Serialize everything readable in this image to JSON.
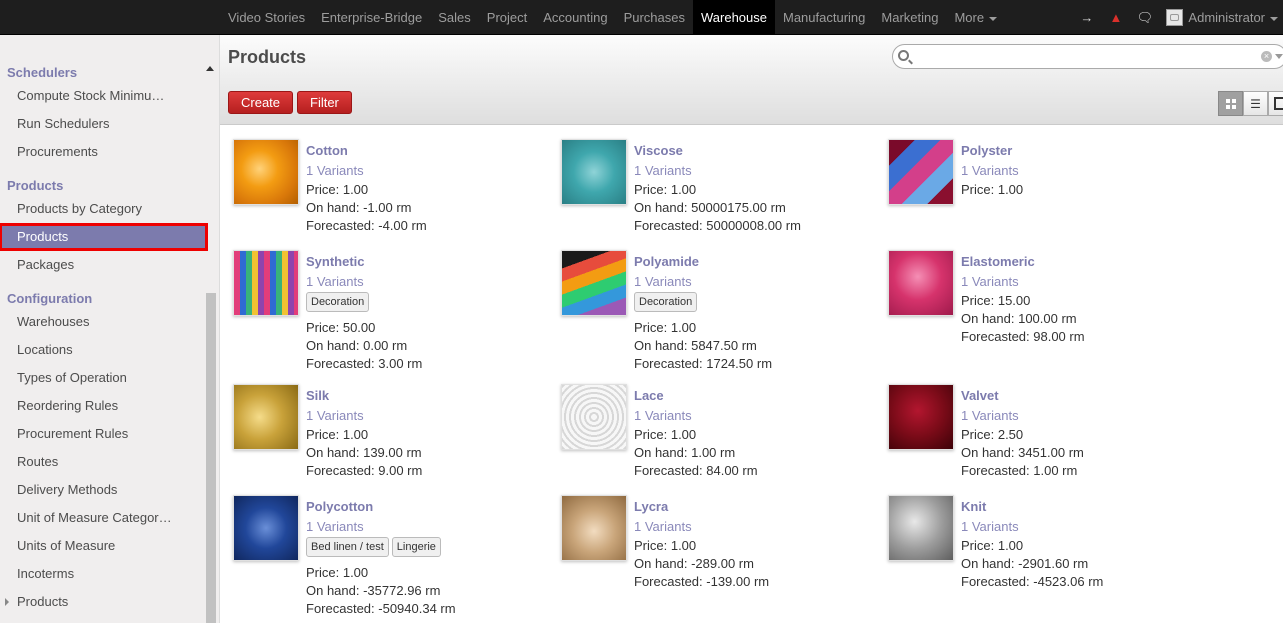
{
  "topnav": {
    "items": [
      "Video Stories",
      "Enterprise-Bridge",
      "Sales",
      "Project",
      "Accounting",
      "Purchases",
      "Warehouse",
      "Manufacturing",
      "Marketing"
    ],
    "more_label": "More",
    "active": "Warehouse",
    "user": "Administrator",
    "icons": [
      "sign-in-icon",
      "warning-icon",
      "chat-icon"
    ]
  },
  "sidebar": {
    "sections": [
      {
        "title": "Schedulers",
        "items": [
          "Compute Stock Minimu…",
          "Run Schedulers",
          "Procurements"
        ]
      },
      {
        "title": "Products",
        "items": [
          "Products by Category",
          "Products",
          "Packages"
        ]
      },
      {
        "title": "Configuration",
        "items": [
          "Warehouses",
          "Locations",
          "Types of Operation",
          "Reordering Rules",
          "Procurement Rules",
          "Routes",
          "Delivery Methods",
          "Unit of Measure Categor…",
          "Units of Measure",
          "Incoterms",
          "Products"
        ]
      }
    ],
    "active_item": "Products"
  },
  "page": {
    "title": "Products",
    "create_label": "Create",
    "filter_label": "Filter",
    "search_value": ""
  },
  "products": [
    {
      "name": "Cotton",
      "variants": "1 Variants",
      "tags": [],
      "price": "Price: 1.00",
      "onhand": "On hand: -1.00 rm",
      "forecast": "Forecasted: -4.00 rm"
    },
    {
      "name": "Viscose",
      "variants": "1 Variants",
      "tags": [],
      "price": "Price: 1.00",
      "onhand": "On hand: 50000175.00 rm",
      "forecast": "Forecasted: 50000008.00 rm"
    },
    {
      "name": "Polyster",
      "variants": "1 Variants",
      "tags": [],
      "price": "Price: 1.00"
    },
    {
      "name": "Synthetic",
      "variants": "1 Variants",
      "tags": [
        "Decoration"
      ],
      "price": "Price: 50.00",
      "onhand": "On hand: 0.00 rm",
      "forecast": "Forecasted: 3.00 rm"
    },
    {
      "name": "Polyamide",
      "variants": "1 Variants",
      "tags": [
        "Decoration"
      ],
      "price": "Price: 1.00",
      "onhand": "On hand: 5847.50 rm",
      "forecast": "Forecasted: 1724.50 rm"
    },
    {
      "name": "Elastomeric",
      "variants": "1 Variants",
      "tags": [],
      "price": "Price: 15.00",
      "onhand": "On hand: 100.00 rm",
      "forecast": "Forecasted: 98.00 rm"
    },
    {
      "name": "Silk",
      "variants": "1 Variants",
      "tags": [],
      "price": "Price: 1.00",
      "onhand": "On hand: 139.00 rm",
      "forecast": "Forecasted: 9.00 rm"
    },
    {
      "name": "Lace",
      "variants": "1 Variants",
      "tags": [],
      "price": "Price: 1.00",
      "onhand": "On hand: 1.00 rm",
      "forecast": "Forecasted: 84.00 rm"
    },
    {
      "name": "Valvet",
      "variants": "1 Variants",
      "tags": [],
      "price": "Price: 2.50",
      "onhand": "On hand: 3451.00 rm",
      "forecast": "Forecasted: 1.00 rm"
    },
    {
      "name": "Polycotton",
      "variants": "1 Variants",
      "tags": [
        "Bed linen / test",
        "Lingerie"
      ],
      "price": "Price: 1.00",
      "onhand": "On hand: -35772.96 rm",
      "forecast": "Forecasted: -50940.34 rm"
    },
    {
      "name": "Lycra",
      "variants": "1 Variants",
      "tags": [],
      "price": "Price: 1.00",
      "onhand": "On hand: -289.00 rm",
      "forecast": "Forecasted: -139.00 rm"
    },
    {
      "name": "Knit",
      "variants": "1 Variants",
      "tags": [],
      "price": "Price: 1.00",
      "onhand": "On hand: -2901.60 rm",
      "forecast": "Forecasted: -4523.06 rm"
    }
  ],
  "colors": {
    "accent": "#7c7bad",
    "button": "#c42525",
    "highlight_outline": "#ee0000",
    "swatches": [
      "#f39c12",
      "#3fa7ad",
      "#b52e57",
      "#7b5ea7",
      "#4aa07a",
      "#d6336c",
      "#c9a23a",
      "#e6e6e6",
      "#7a0b18",
      "#21479a",
      "#c9a57a",
      "#9d9d9d"
    ]
  }
}
